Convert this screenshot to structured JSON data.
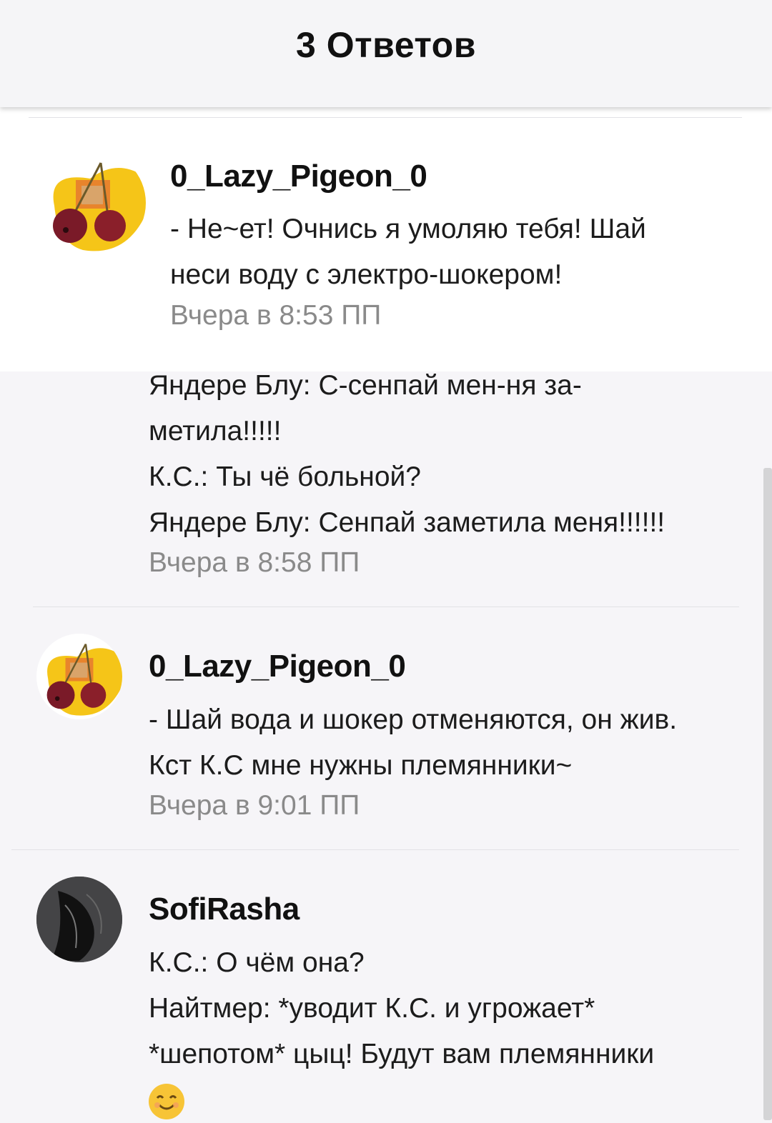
{
  "header": {
    "title": "3 Ответов"
  },
  "comments": [
    {
      "username": "0_Lazy_Pigeon_0",
      "lines": [
        "- Не~ет! Очнись я умоляю тебя! Шай",
        "неси воду с электро-шокером!"
      ],
      "time": "Вчера в 8:53 ПП"
    },
    {
      "username": "",
      "lines": [
        "Яндере Блу: С-сенпай мен-ня за-",
        "метила!!!!!",
        "К.С.: Ты чё больной?",
        "Яндере Блу: Сенпай заметила меня!!!!!!"
      ],
      "time": "Вчера в 8:58 ПП"
    },
    {
      "username": "0_Lazy_Pigeon_0",
      "lines": [
        "- Шай вода и шокер отменяются, он жив.",
        "Кст К.С мне нужны племянники~"
      ],
      "time": "Вчера в 9:01 ПП"
    },
    {
      "username": "SofiRasha",
      "lines": [
        "К.С.: О чём она?",
        "Найтмер: *уводит К.С. и угрожает*",
        "*шепотом* цыц! Будут вам племянники"
      ],
      "emoji": "smiling-face-emoji"
    }
  ],
  "colors": {
    "accent_yellow": "#f5c518",
    "cherry": "#8a1f2a"
  },
  "icons": [
    "cherry-avatar",
    "dark-avatar",
    "smiling-face-emoji"
  ]
}
